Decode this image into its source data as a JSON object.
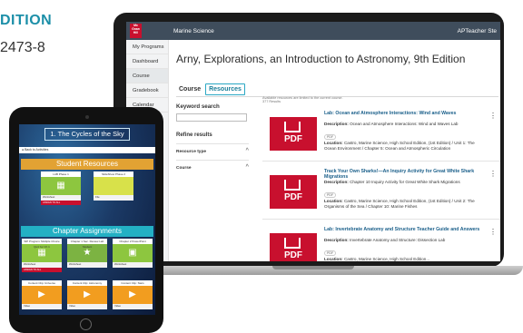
{
  "header_text": {
    "edition": "DITION",
    "isbn": "2473-8"
  },
  "laptop": {
    "topbar": {
      "logo": "Mc Graw Hill",
      "course": "Marine Science",
      "user": "APTeacher Ste"
    },
    "sidebar": [
      "My Programs",
      "Dashboard",
      "Course",
      "Gradebook",
      "Calendar"
    ],
    "page_title": "Arny, Explorations, an Introduction to Astronomy, 9th Edition",
    "tabs": [
      "Course",
      "Resources"
    ],
    "filters": {
      "keyword_label": "Keyword search",
      "refine_label": "Refine results",
      "rows": [
        "Resource type",
        "Course"
      ]
    },
    "results_note": "Available resources are limited to the current course.",
    "results_count": "377 Results",
    "results": [
      {
        "title": "Lab: Ocean and Atmosphere Interactions: Wind and Waves",
        "desc_label": "Description:",
        "desc": "Ocean and Atmosphere Interactions: Wind and Waves Lab",
        "badge": "PDF",
        "loc_label": "Location:",
        "loc": "Castro, Marine Science, High School Edition, (1st Edition) / Unit 1: The Ocean Environment / Chapter 5: Ocean and Atmospheric Circulation"
      },
      {
        "title": "Track Your Own Sharks!—An Inquiry Activity for Great White Shark Migrations",
        "desc_label": "Description:",
        "desc": "Chapter 10 Inquiry Activity for Great White Shark Migrations",
        "badge": "PDF",
        "loc_label": "Location:",
        "loc": "Castro, Marine Science, High School Edition, (1st Edition) / Unit 2: The Organisms of the Sea / Chapter 10: Marine Fishes"
      },
      {
        "title": "Lab: Invertebrate Anatomy and Structure Teacher Guide and Answers",
        "desc_label": "Description:",
        "desc": "Invertebrate Anatomy and Structure: Dissection Lab",
        "badge": "PDF",
        "loc_label": "Location:",
        "loc": "Castro, Marine Science, High School Edition..."
      }
    ],
    "pdf_label": "PDF"
  },
  "tablet": {
    "unit_title": "1. The Cycles of the Sky",
    "back_label": "● Back to Activities",
    "student_resources": "Student Resources",
    "chapter_assignments": "Chapter Assignments",
    "resource_cards": [
      {
        "title": "LAB Phase 1",
        "body": "Worksheet"
      },
      {
        "title": "SlideShow Phase 2",
        "body": "File"
      }
    ],
    "assignment_cards": [
      {
        "title": "SIP Program: Multiple Choice Quiz for Ch 1",
        "body": "Worksheet"
      },
      {
        "title": "Chapter 1 Sec. Review Lab Student",
        "body": "Worksheet"
      },
      {
        "title": "Chapter 2 PowerPoint",
        "body": "Worksheet"
      },
      {
        "title": "Content Clip: Universe",
        "body": "Video"
      },
      {
        "title": "Content Clip: Astronomy",
        "body": "Video"
      },
      {
        "title": "Content Clip: Stars",
        "body": "Video"
      }
    ],
    "button_label": "ASSIGN TO ALL"
  }
}
